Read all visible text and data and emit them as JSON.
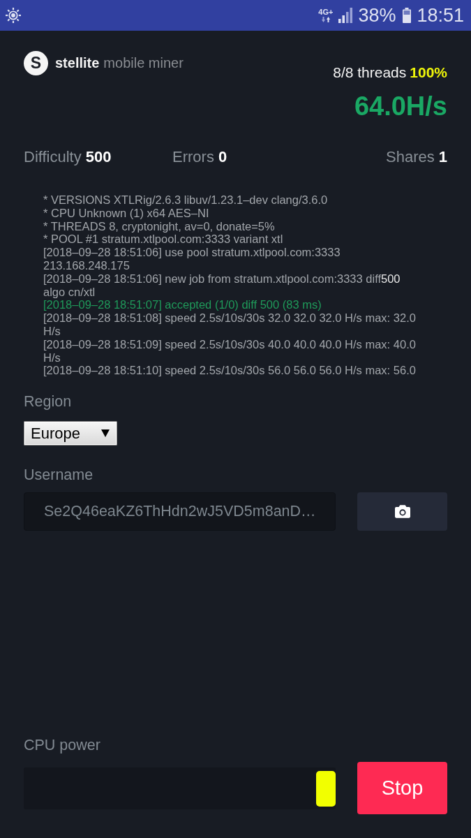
{
  "status_bar": {
    "network": "4G+",
    "battery": "38%",
    "time": "18:51"
  },
  "header": {
    "logo": {
      "mark": "S",
      "brand": "stellite",
      "product": "mobile miner"
    },
    "threads": "8/8 threads",
    "usage": "100%",
    "hashrate": "64.0H/s"
  },
  "stats": [
    {
      "label": "Difficulty",
      "value": "500"
    },
    {
      "label": "Errors",
      "value": "0"
    },
    {
      "label": "Shares",
      "value": "1"
    }
  ],
  "log": [
    {
      "kind": "info",
      "text": "* VERSIONS XTLRig/2.6.3 libuv/1.23.1–dev clang/3.6.0"
    },
    {
      "kind": "info",
      "text": "* CPU Unknown (1) x64 AES–NI"
    },
    {
      "kind": "info",
      "text": "* THREADS 8, cryptonight, av=0, donate=5%"
    },
    {
      "kind": "info",
      "text": "* POOL #1 stratum.xtlpool.com:3333 variant xtl"
    },
    {
      "kind": "info",
      "text": "[2018–09–28 18:51:06] use pool stratum.xtlpool.com:3333 213.168.248.175"
    },
    {
      "kind": "info",
      "text": "[2018–09–28 18:51:06] new job from stratum.xtlpool.com:3333 diff**500** algo cn/xtl"
    },
    {
      "kind": "accepted",
      "text": "[2018–09–28 18:51:07] accepted (1/0) diff 500 (83 ms)"
    },
    {
      "kind": "info",
      "text": "[2018–09–28 18:51:08] speed 2.5s/10s/30s 32.0 32.0 32.0 H/s max: 32.0 H/s"
    },
    {
      "kind": "info",
      "text": "[2018–09–28 18:51:09] speed 2.5s/10s/30s 40.0 40.0 40.0 H/s max: 40.0 H/s"
    },
    {
      "kind": "info",
      "text": "[2018–09–28 18:51:10] speed 2.5s/10s/30s 56.0 56.0 56.0 H/s max: 56.0"
    }
  ],
  "region": {
    "label": "Region",
    "value": "Europe"
  },
  "username": {
    "label": "Username",
    "value": "Se2Q46eaKZ6ThHdn2wJ5VD5m8anD…"
  },
  "cpu_power": {
    "label": "CPU power",
    "level": 1
  },
  "stop_button": {
    "label": "Stop"
  }
}
